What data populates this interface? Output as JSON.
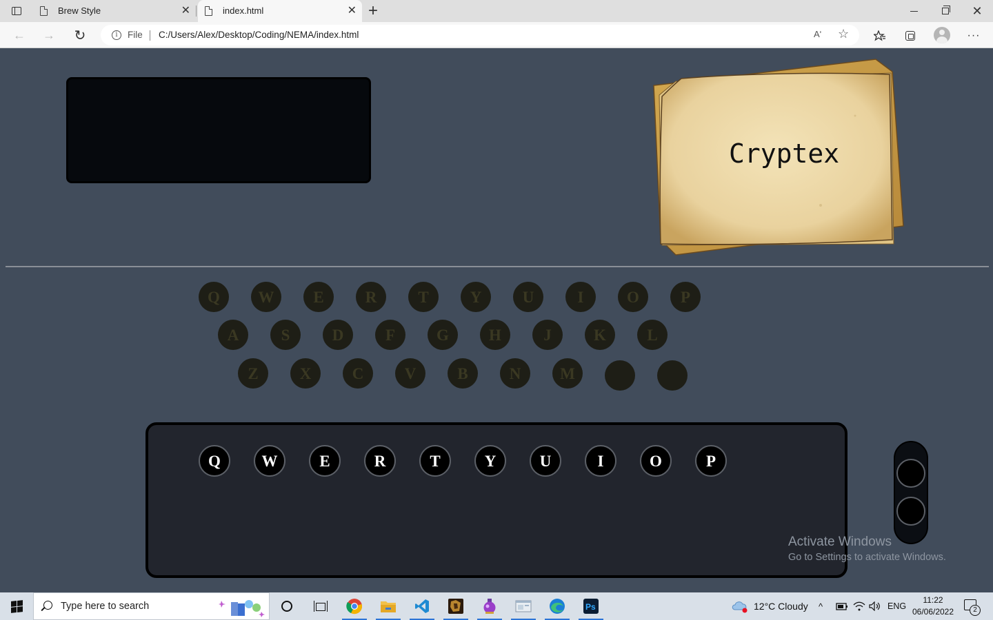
{
  "browser": {
    "tabs": [
      {
        "title": "Brew Style",
        "close": "✕"
      },
      {
        "title": "index.html",
        "close": "✕"
      }
    ],
    "new_tab": "+",
    "window_controls": {
      "close": "✕"
    },
    "address": {
      "security_label": "File",
      "url": "C:/Users/Alex/Desktop/Coding/NEMA/index.html",
      "read_aloud": "Aʹ"
    },
    "nav": {
      "back": "←",
      "forward": "→",
      "reload": "↻"
    },
    "more_menu": "···",
    "favorites": "☆"
  },
  "page": {
    "paper_title": "Cryptex",
    "lampboard_rows": [
      [
        "Q",
        "W",
        "E",
        "R",
        "T",
        "Y",
        "U",
        "I",
        "O",
        "P"
      ],
      [
        "A",
        "S",
        "D",
        "F",
        "G",
        "H",
        "J",
        "K",
        "L"
      ],
      [
        "Z",
        "X",
        "C",
        "V",
        "B",
        "N",
        "M",
        "",
        ""
      ]
    ],
    "keyboard_keys": [
      "Q",
      "W",
      "E",
      "R",
      "T",
      "Y",
      "U",
      "I",
      "O",
      "P"
    ],
    "colors": {
      "background": "#414c5b",
      "display": "#06090d",
      "lamp": "#1e1e16",
      "lamp_letter": "#3a3822",
      "keyboard_panel": "#22252d",
      "key": "#000000",
      "paper": "#e9d6a8"
    }
  },
  "watermark": {
    "title": "Activate Windows",
    "subtitle": "Go to Settings to activate Windows."
  },
  "taskbar": {
    "search_placeholder": "Type here to search",
    "weather": "12°C  Cloudy",
    "chevron": "^",
    "language": "ENG",
    "time": "11:22",
    "date": "06/06/2022",
    "notification_count": "2",
    "pinned_apps": [
      "chrome-icon",
      "file-explorer-icon",
      "vscode-icon",
      "dragon-game-icon",
      "potion-app-icon",
      "window-app-icon",
      "edge-icon",
      "photoshop-icon"
    ]
  }
}
